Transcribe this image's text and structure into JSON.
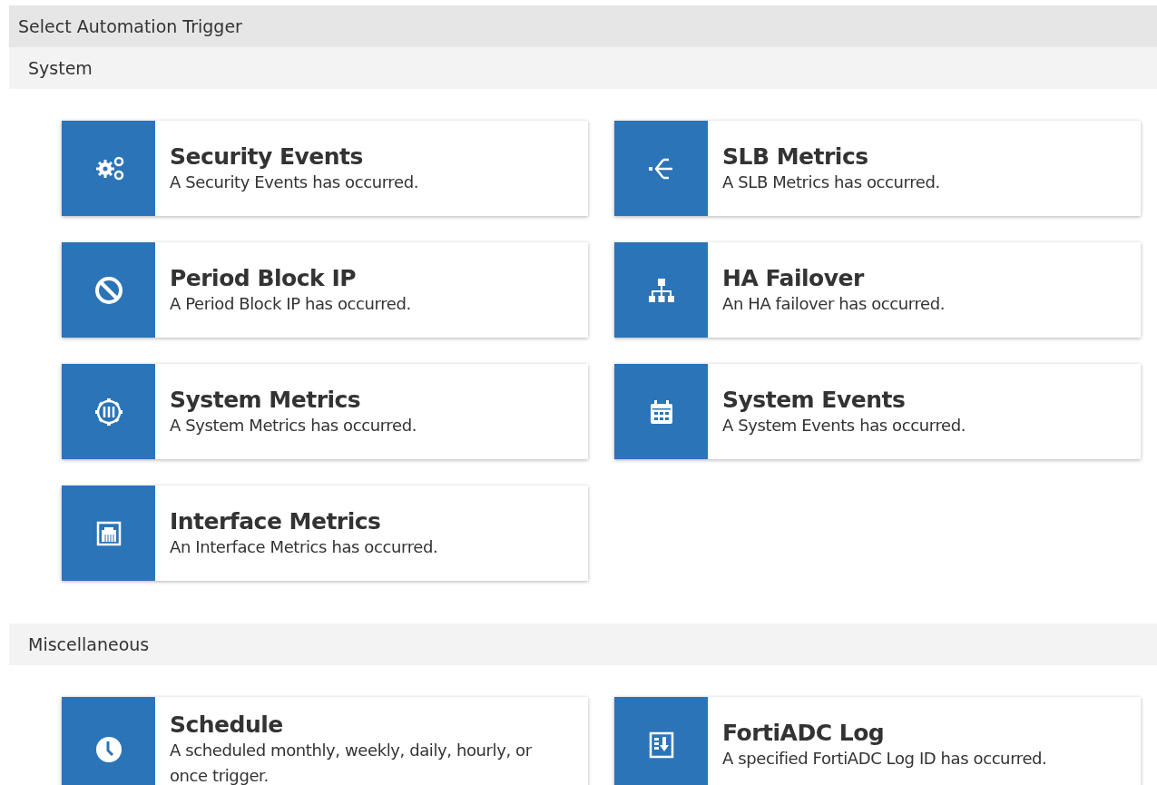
{
  "header": {
    "title": "Select Automation Trigger"
  },
  "sections": [
    {
      "title": "System",
      "cards": [
        {
          "title": "Security Events",
          "description": "A Security Events has occurred."
        },
        {
          "title": "SLB Metrics",
          "description": "A SLB Metrics has occurred."
        },
        {
          "title": "Period Block IP",
          "description": "A Period Block IP has occurred."
        },
        {
          "title": "HA Failover",
          "description": "An HA failover has occurred."
        },
        {
          "title": "System Metrics",
          "description": "A System Metrics has occurred."
        },
        {
          "title": "System Events",
          "description": "A System Events has occurred."
        },
        {
          "title": "Interface Metrics",
          "description": "An Interface Metrics has occurred."
        }
      ]
    },
    {
      "title": "Miscellaneous",
      "cards": [
        {
          "title": "Schedule",
          "description": "A scheduled monthly, weekly, daily, hourly, or once trigger."
        },
        {
          "title": "FortiADC Log",
          "description": "A specified FortiADC Log ID has occurred."
        }
      ]
    }
  ]
}
